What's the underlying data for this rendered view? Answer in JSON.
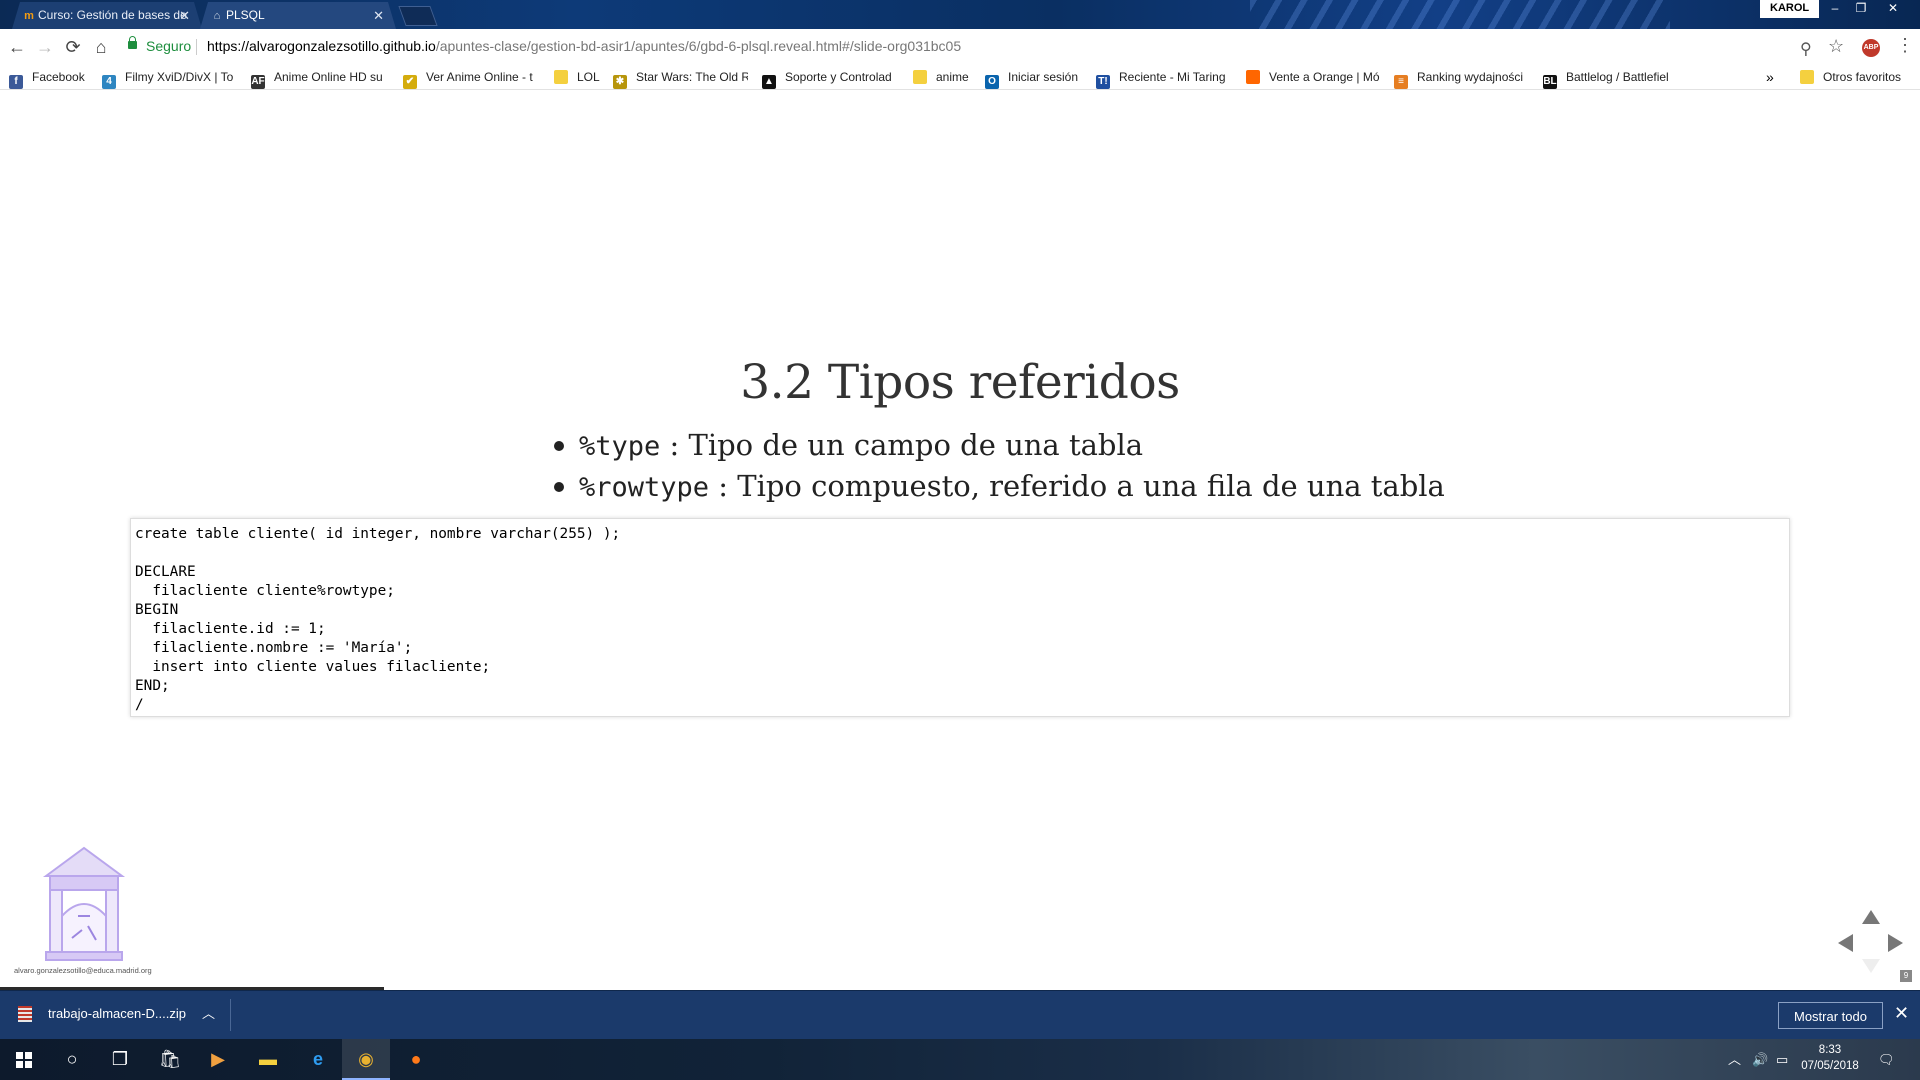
{
  "browser": {
    "tabs": [
      {
        "label": "Curso: Gestión de bases de",
        "icon": "moodle-icon",
        "active": false
      },
      {
        "label": "PLSQL",
        "icon": "page-icon",
        "active": true
      }
    ],
    "user": "KAROL",
    "window_buttons": {
      "minimize": "–",
      "restore": "❐",
      "close": "✕"
    },
    "nav": {
      "back": "←",
      "forward": "→",
      "reload": "⟳",
      "home": "⌂"
    },
    "security_label": "Seguro",
    "url_host": "https://alvarogonzalezsotillo.github.io",
    "url_path": "/apuntes-clase/gestion-bd-asir1/apuntes/6/gbd-6-plsql.reveal.html#/slide-org031bc05",
    "extensions": {
      "abp": "ABP"
    }
  },
  "bookmarks": [
    {
      "label": "Facebook",
      "icon": "f",
      "color": "#3b5998"
    },
    {
      "label": "Filmy XviD/DivX | To",
      "icon": "4",
      "color": "#2e86c1"
    },
    {
      "label": "Anime Online HD su",
      "icon": "AF",
      "color": "#333333"
    },
    {
      "label": "Ver Anime Online - t",
      "icon": "✔",
      "color": "#d4ac0d"
    },
    {
      "label": "LOL",
      "icon": "",
      "color": "folder"
    },
    {
      "label": "Star Wars: The Old R",
      "icon": "✱",
      "color": "#b7950b"
    },
    {
      "label": "Soporte y Controlad",
      "icon": "▲",
      "color": "#111111"
    },
    {
      "label": "anime",
      "icon": "",
      "color": "folder"
    },
    {
      "label": "Iniciar sesión",
      "icon": "O",
      "color": "#0a64ad"
    },
    {
      "label": "Reciente - Mi Taring",
      "icon": "T!",
      "color": "#1f4fa0"
    },
    {
      "label": "Vente a Orange | Mó",
      "icon": "",
      "color": "#ff6600"
    },
    {
      "label": "Ranking wydajności",
      "icon": "≡",
      "color": "#e67e22"
    },
    {
      "label": "Battlelog / Battlefiel",
      "icon": "BL",
      "color": "#111111"
    }
  ],
  "bookmarks_more": "»",
  "other_bookmarks": "Otros favoritos",
  "slide": {
    "title": "3.2 Tipos referidos",
    "bullets": [
      {
        "code": "%type",
        "text": " : Tipo de un campo de una tabla"
      },
      {
        "code": "%rowtype",
        "text": " : Tipo compuesto, referido a una fila de una tabla"
      }
    ],
    "code": "create table cliente( id integer, nombre varchar(255) );\n\nDECLARE\n  filacliente cliente%rowtype;\nBEGIN\n  filacliente.id := 1;\n  filacliente.nombre := 'María';\n  insert into cliente values filacliente;\nEND;\n/",
    "author_email": "alvaro.gonzalezsotillo@educa.madrid.org",
    "slide_number": "9"
  },
  "downloads": {
    "file_name": "trabajo-almacen-D....zip",
    "show_all": "Mostrar todo",
    "close": "✕"
  },
  "taskbar": {
    "time": "8:33",
    "date": "07/05/2018"
  }
}
